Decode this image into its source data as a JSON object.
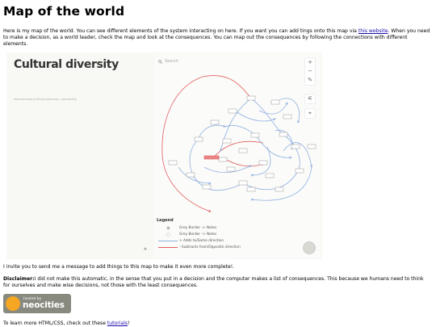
{
  "page": {
    "title": "Map of the world",
    "intro_text": "Here is my map of the world. You can see different elements of the system interacting on here. If you want you can add tings onto this map via ",
    "intro_link": "this website",
    "intro_text_2": ". When you need to make a decision, as a world leader, check the map and look at the consequences. You can map out the consequences by following the connections with different elements."
  },
  "embed": {
    "title": "Cultural diversity",
    "breadcrumb": "#introduction/cultural-diversity | permalink",
    "search_placeholder": "Search",
    "controls": {
      "zoom_in": "+",
      "zoom_out": "−",
      "edit": "✎",
      "filter": "⚟",
      "locate": "⌖"
    },
    "legend": {
      "title": "Legend",
      "items": [
        {
          "label": "Grey Border -> Notes"
        },
        {
          "label": "Grey Border -> Notes"
        },
        {
          "label": "+ Adds to/Same direction"
        },
        {
          "label": "- Subtracts from/Opposite direction"
        }
      ]
    },
    "compass_glyph": "⟡",
    "colors": {
      "add": "#8fb0e0",
      "subtract": "#e06060",
      "node_border": "#999999"
    }
  },
  "footer": {
    "invite": "I invite you to send me a message to add things to this map to make it even more complete!.",
    "disclaimer_label": "Disclaimer:",
    "disclaimer_text": "I did not make this automatic, in the sense that you put in a decision and the computer makes a list of consequences. This because we humans need to think for ourselves and make wise decisions, not those with the least consequences.",
    "badge_small": "hosted by",
    "badge_big": "neocities",
    "tutorials_text": "To learn more HTML/CSS, check out these ",
    "tutorials_link": "tutorials",
    "tutorials_end": "!"
  }
}
